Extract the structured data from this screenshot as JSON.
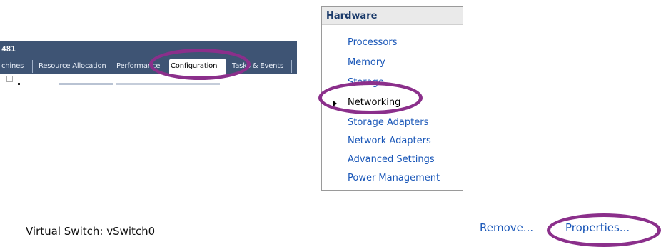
{
  "tab_panel": {
    "title": "481",
    "tabs": [
      "chines",
      "Resource Allocation",
      "Performance",
      "Configuration",
      "Tasks & Events"
    ],
    "active_tab": "Configuration"
  },
  "hardware": {
    "header": "Hardware",
    "items": [
      "Processors",
      "Memory",
      "Storage",
      "Networking",
      "Storage Adapters",
      "Network Adapters",
      "Advanced Settings",
      "Power Management"
    ],
    "selected": "Networking"
  },
  "virtual_switch": {
    "label": "Virtual Switch: vSwitch0",
    "remove_link": "Remove...",
    "properties_link": "Properties..."
  },
  "colors": {
    "tab_bar": "#3e5474",
    "link": "#1a57b8",
    "highlight": "#8b2f8b"
  }
}
